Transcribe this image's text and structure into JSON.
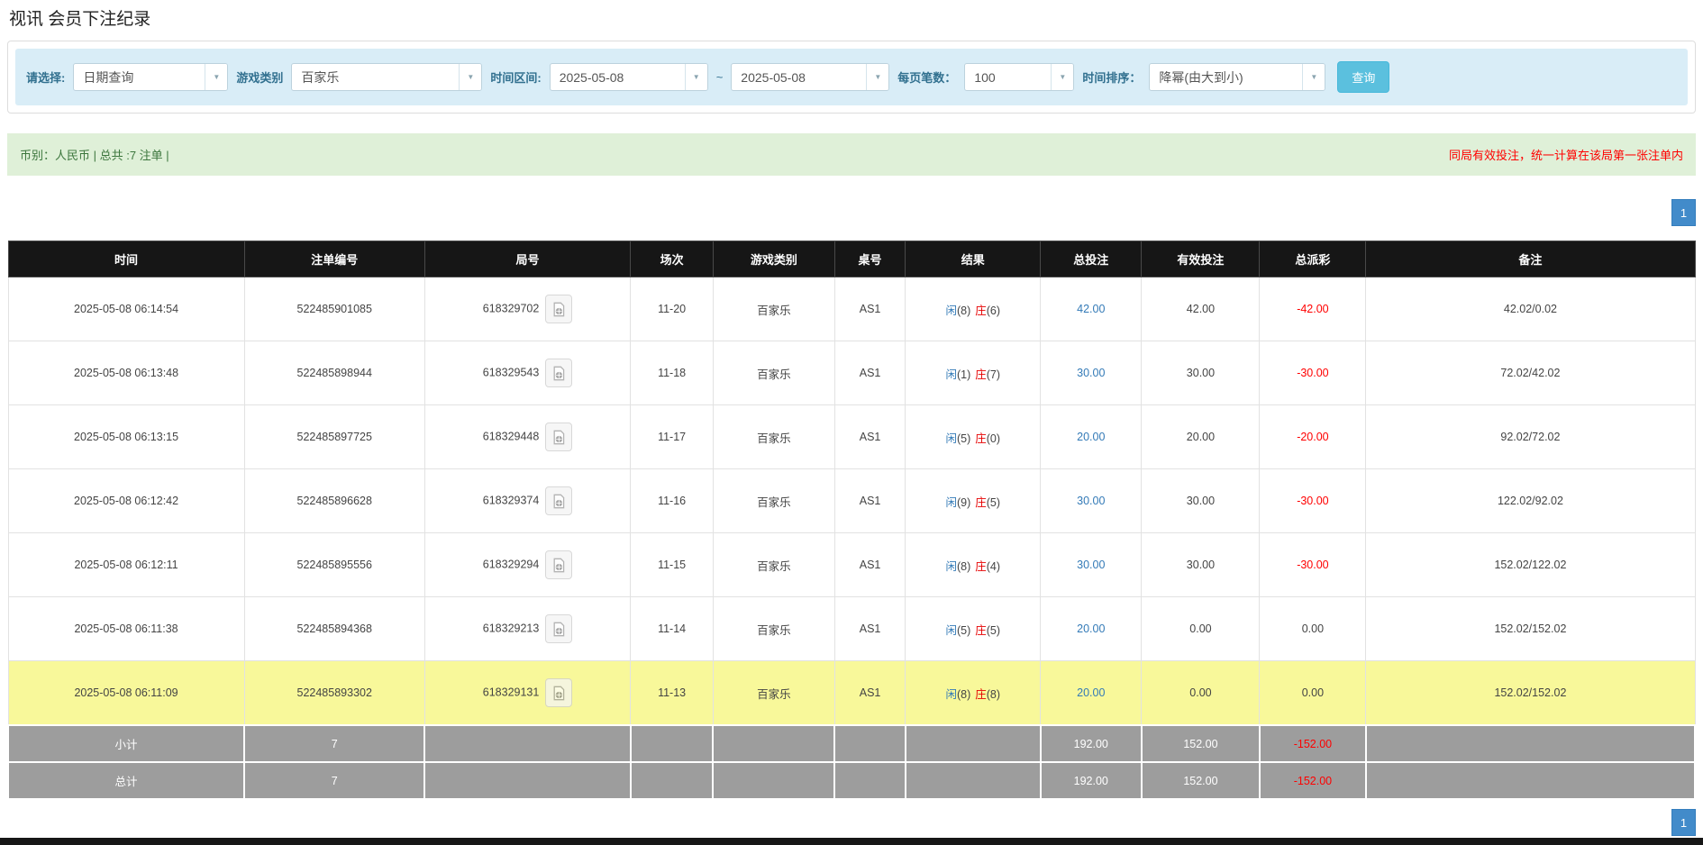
{
  "page": {
    "title": "视讯 会员下注纪录"
  },
  "filters": {
    "select_label": "请选择:",
    "select_value": "日期查询",
    "game_label": "游戏类别",
    "game_value": "百家乐",
    "range_label": "时间区间:",
    "date_from": "2025-05-08",
    "range_separator": "~",
    "date_to": "2025-05-08",
    "per_page_label": "每页笔数：",
    "per_page_value": "100",
    "sort_label": "时间排序：",
    "sort_value": "降幂(由大到小)",
    "search_button": "查询",
    "accent_color": "#5bc0de"
  },
  "summary": {
    "left": "币别：人民币 | 总共 :7 注单 |",
    "right": "同局有效投注，统一计算在该局第一张注单内",
    "bg_color": "#dff0d8",
    "left_color": "#3c763d",
    "right_color": "#ff0000"
  },
  "pagination": {
    "current_page": "1"
  },
  "table": {
    "headers": [
      "时间",
      "注单编号",
      "局号",
      "场次",
      "游戏类别",
      "桌号",
      "结果",
      "总投注",
      "有效投注",
      "总派彩",
      "备注"
    ],
    "rows": [
      {
        "time": "2025-05-08 06:14:54",
        "bet_id": "522485901085",
        "round_id": "618329702",
        "session": "11-20",
        "game": "百家乐",
        "table_no": "AS1",
        "result_player": "闲",
        "result_player_score": "(8)",
        "result_banker": "庄",
        "result_banker_score": "(6)",
        "total_bet": "42.00",
        "valid_bet": "42.00",
        "payout": "-42.00",
        "remark": "42.02/0.02",
        "highlight": false
      },
      {
        "time": "2025-05-08 06:13:48",
        "bet_id": "522485898944",
        "round_id": "618329543",
        "session": "11-18",
        "game": "百家乐",
        "table_no": "AS1",
        "result_player": "闲",
        "result_player_score": "(1)",
        "result_banker": "庄",
        "result_banker_score": "(7)",
        "total_bet": "30.00",
        "valid_bet": "30.00",
        "payout": "-30.00",
        "remark": "72.02/42.02",
        "highlight": false
      },
      {
        "time": "2025-05-08 06:13:15",
        "bet_id": "522485897725",
        "round_id": "618329448",
        "session": "11-17",
        "game": "百家乐",
        "table_no": "AS1",
        "result_player": "闲",
        "result_player_score": "(5)",
        "result_banker": "庄",
        "result_banker_score": "(0)",
        "total_bet": "20.00",
        "valid_bet": "20.00",
        "payout": "-20.00",
        "remark": "92.02/72.02",
        "highlight": false
      },
      {
        "time": "2025-05-08 06:12:42",
        "bet_id": "522485896628",
        "round_id": "618329374",
        "session": "11-16",
        "game": "百家乐",
        "table_no": "AS1",
        "result_player": "闲",
        "result_player_score": "(9)",
        "result_banker": "庄",
        "result_banker_score": "(5)",
        "total_bet": "30.00",
        "valid_bet": "30.00",
        "payout": "-30.00",
        "remark": "122.02/92.02",
        "highlight": false
      },
      {
        "time": "2025-05-08 06:12:11",
        "bet_id": "522485895556",
        "round_id": "618329294",
        "session": "11-15",
        "game": "百家乐",
        "table_no": "AS1",
        "result_player": "闲",
        "result_player_score": "(8)",
        "result_banker": "庄",
        "result_banker_score": "(4)",
        "total_bet": "30.00",
        "valid_bet": "30.00",
        "payout": "-30.00",
        "remark": "152.02/122.02",
        "highlight": false
      },
      {
        "time": "2025-05-08 06:11:38",
        "bet_id": "522485894368",
        "round_id": "618329213",
        "session": "11-14",
        "game": "百家乐",
        "table_no": "AS1",
        "result_player": "闲",
        "result_player_score": "(5)",
        "result_banker": "庄",
        "result_banker_score": "(5)",
        "total_bet": "20.00",
        "valid_bet": "0.00",
        "payout": "0.00",
        "remark": "152.02/152.02",
        "highlight": false
      },
      {
        "time": "2025-05-08 06:11:09",
        "bet_id": "522485893302",
        "round_id": "618329131",
        "session": "11-13",
        "game": "百家乐",
        "table_no": "AS1",
        "result_player": "闲",
        "result_player_score": "(8)",
        "result_banker": "庄",
        "result_banker_score": "(8)",
        "total_bet": "20.00",
        "valid_bet": "0.00",
        "payout": "0.00",
        "remark": "152.02/152.02",
        "highlight": true
      }
    ],
    "subtotal": {
      "label": "小计",
      "count": "7",
      "total_bet": "192.00",
      "valid_bet": "152.00",
      "payout": "-152.00"
    },
    "total": {
      "label": "总计",
      "count": "7",
      "total_bet": "192.00",
      "valid_bet": "152.00",
      "payout": "-152.00"
    },
    "colors": {
      "header_bg": "#161616",
      "highlight_row": "#f8f89a",
      "footer_bg": "#9d9d9d",
      "link": "#337ab7",
      "player": "#337ab7",
      "banker": "#e60000",
      "negative": "#ff0000"
    }
  }
}
